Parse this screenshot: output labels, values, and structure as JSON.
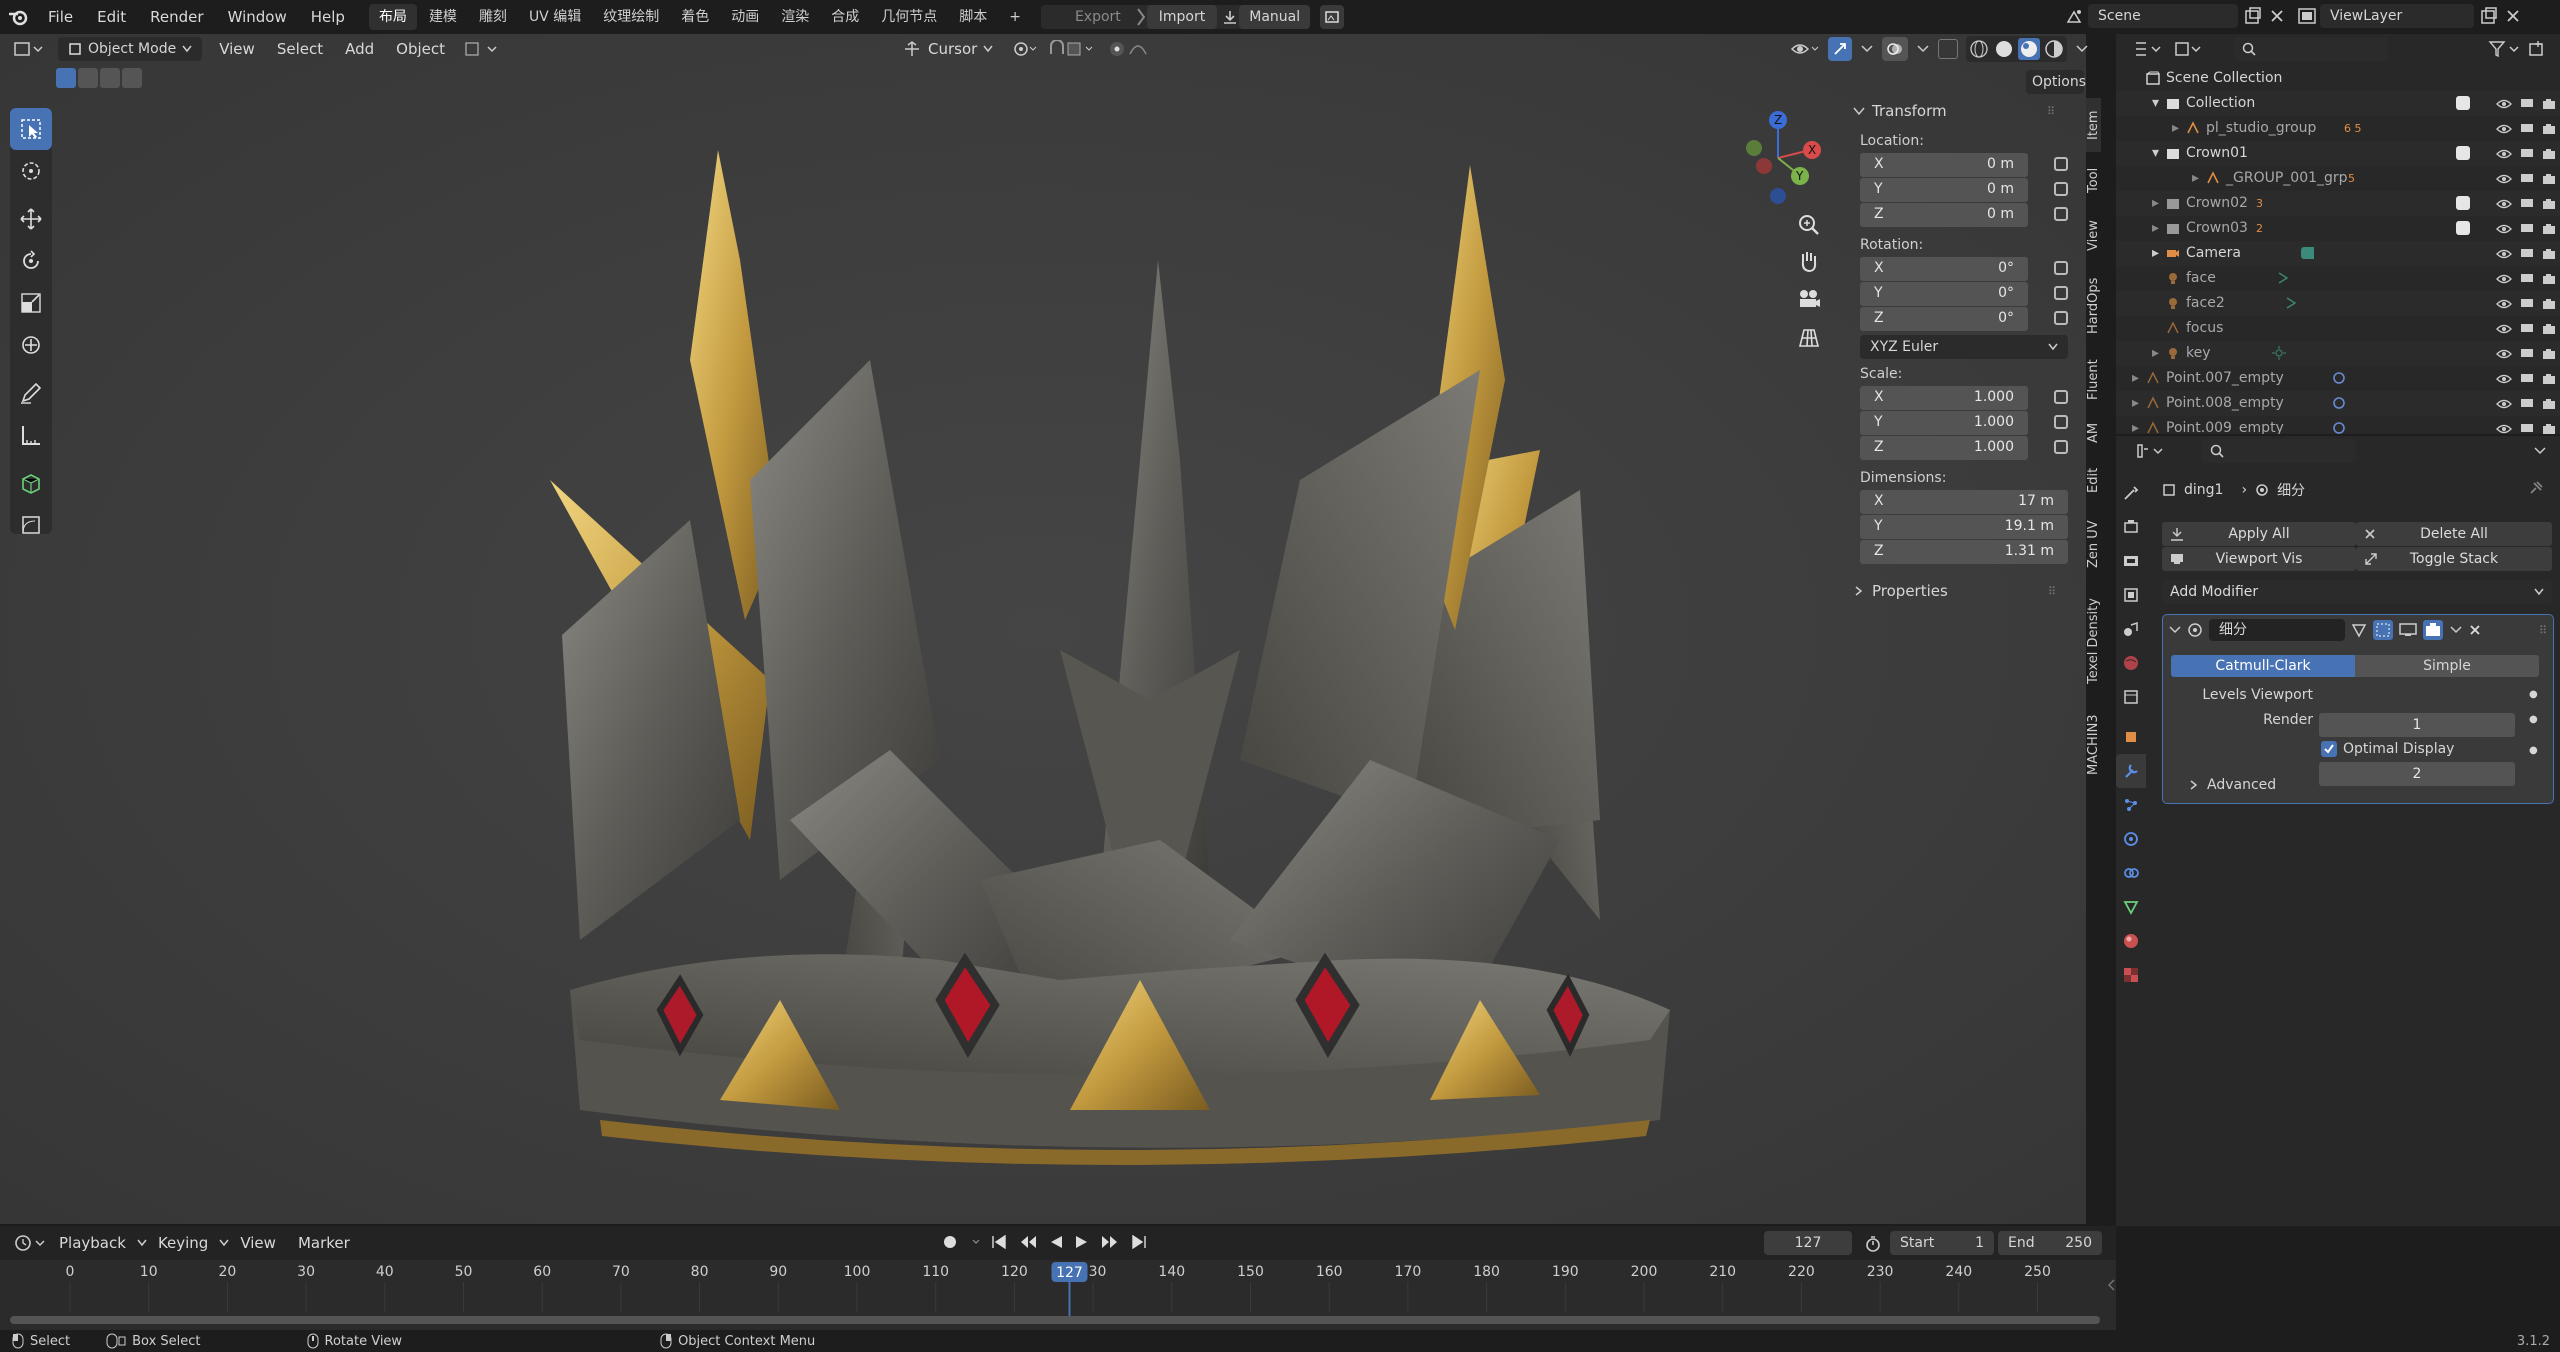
{
  "topbar": {
    "menus": [
      "File",
      "Edit",
      "Render",
      "Window",
      "Help"
    ],
    "workspaces": [
      "布局",
      "建模",
      "雕刻",
      "UV 编辑",
      "纹理绘制",
      "着色",
      "动画",
      "渲染",
      "合成",
      "几何节点",
      "脚本"
    ],
    "active_workspace": "布局",
    "add_tab": "+",
    "export_label": "Export",
    "import_label": "Import",
    "manual_label": "Manual",
    "scene": "Scene",
    "view_layer": "ViewLayer"
  },
  "viewport_header": {
    "mode": "Object Mode",
    "menus": [
      "View",
      "Select",
      "Add",
      "Object"
    ],
    "pivot": "Cursor",
    "options": "Options"
  },
  "npanel": {
    "title": "Transform",
    "location_label": "Location:",
    "location": [
      {
        "axis": "X",
        "value": "0 m"
      },
      {
        "axis": "Y",
        "value": "0 m"
      },
      {
        "axis": "Z",
        "value": "0 m"
      }
    ],
    "rotation_label": "Rotation:",
    "rotation": [
      {
        "axis": "X",
        "value": "0°"
      },
      {
        "axis": "Y",
        "value": "0°"
      },
      {
        "axis": "Z",
        "value": "0°"
      }
    ],
    "rotation_mode": "XYZ Euler",
    "scale_label": "Scale:",
    "scale": [
      {
        "axis": "X",
        "value": "1.000"
      },
      {
        "axis": "Y",
        "value": "1.000"
      },
      {
        "axis": "Z",
        "value": "1.000"
      }
    ],
    "dimensions_label": "Dimensions:",
    "dimensions": [
      {
        "axis": "X",
        "value": "17 m"
      },
      {
        "axis": "Y",
        "value": "19.1 m"
      },
      {
        "axis": "Z",
        "value": "1.31 m"
      }
    ],
    "properties_label": "Properties",
    "tabs": [
      "Item",
      "Tool",
      "View",
      "HardOps",
      "Fluent",
      "AM",
      "Edit",
      "Zen UV",
      "Texel Density",
      "MACHIN3"
    ]
  },
  "outliner": {
    "root": "Scene Collection",
    "rows": [
      {
        "name": "Collection",
        "badge": ""
      },
      {
        "name": "pl_studio_group",
        "badge": "6 5"
      },
      {
        "name": "Crown01",
        "badge": ""
      },
      {
        "name": "_GROUP_001_grp",
        "badge": "5"
      },
      {
        "name": "Crown02",
        "badge": "3"
      },
      {
        "name": "Crown03",
        "badge": "2"
      },
      {
        "name": "Camera",
        "badge": ""
      },
      {
        "name": "face",
        "badge": ""
      },
      {
        "name": "face2",
        "badge": ""
      },
      {
        "name": "focus",
        "badge": ""
      },
      {
        "name": "key",
        "badge": ""
      },
      {
        "name": "Point.007_empty",
        "badge": ""
      },
      {
        "name": "Point.008_empty",
        "badge": ""
      },
      {
        "name": "Point.009_empty",
        "badge": ""
      }
    ]
  },
  "properties": {
    "object": "ding1",
    "modifier_context": "细分",
    "apply_all": "Apply All",
    "delete_all": "Delete All",
    "viewport_vis": "Viewport Vis",
    "toggle_stack": "Toggle Stack",
    "add_modifier": "Add Modifier",
    "modifier_name": "细分",
    "catmull": "Catmull-Clark",
    "simple": "Simple",
    "levels_viewport_label": "Levels Viewport",
    "levels_viewport": "1",
    "render_label": "Render",
    "render": "2",
    "optimal_display": "Optimal Display",
    "advanced": "Advanced"
  },
  "timeline": {
    "menus": [
      "Playback",
      "Keying",
      "View",
      "Marker"
    ],
    "current_frame": "127",
    "start_label": "Start",
    "start": "1",
    "end_label": "End",
    "end": "250",
    "ticks": [
      "0",
      "10",
      "20",
      "30",
      "40",
      "50",
      "60",
      "70",
      "80",
      "90",
      "100",
      "110",
      "120",
      "130",
      "140",
      "150",
      "160",
      "170",
      "180",
      "190",
      "200",
      "210",
      "220",
      "230",
      "240",
      "250"
    ],
    "playhead_value": 127
  },
  "statusbar": {
    "select": "Select",
    "box_select": "Box Select",
    "rotate_view": "Rotate View",
    "context_menu": "Object Context Menu",
    "version": "3.1.2"
  },
  "colors": {
    "accent": "#4772b3",
    "gold": "#c9a24a",
    "gem": "#b01828",
    "steel": "#6a6a66"
  }
}
